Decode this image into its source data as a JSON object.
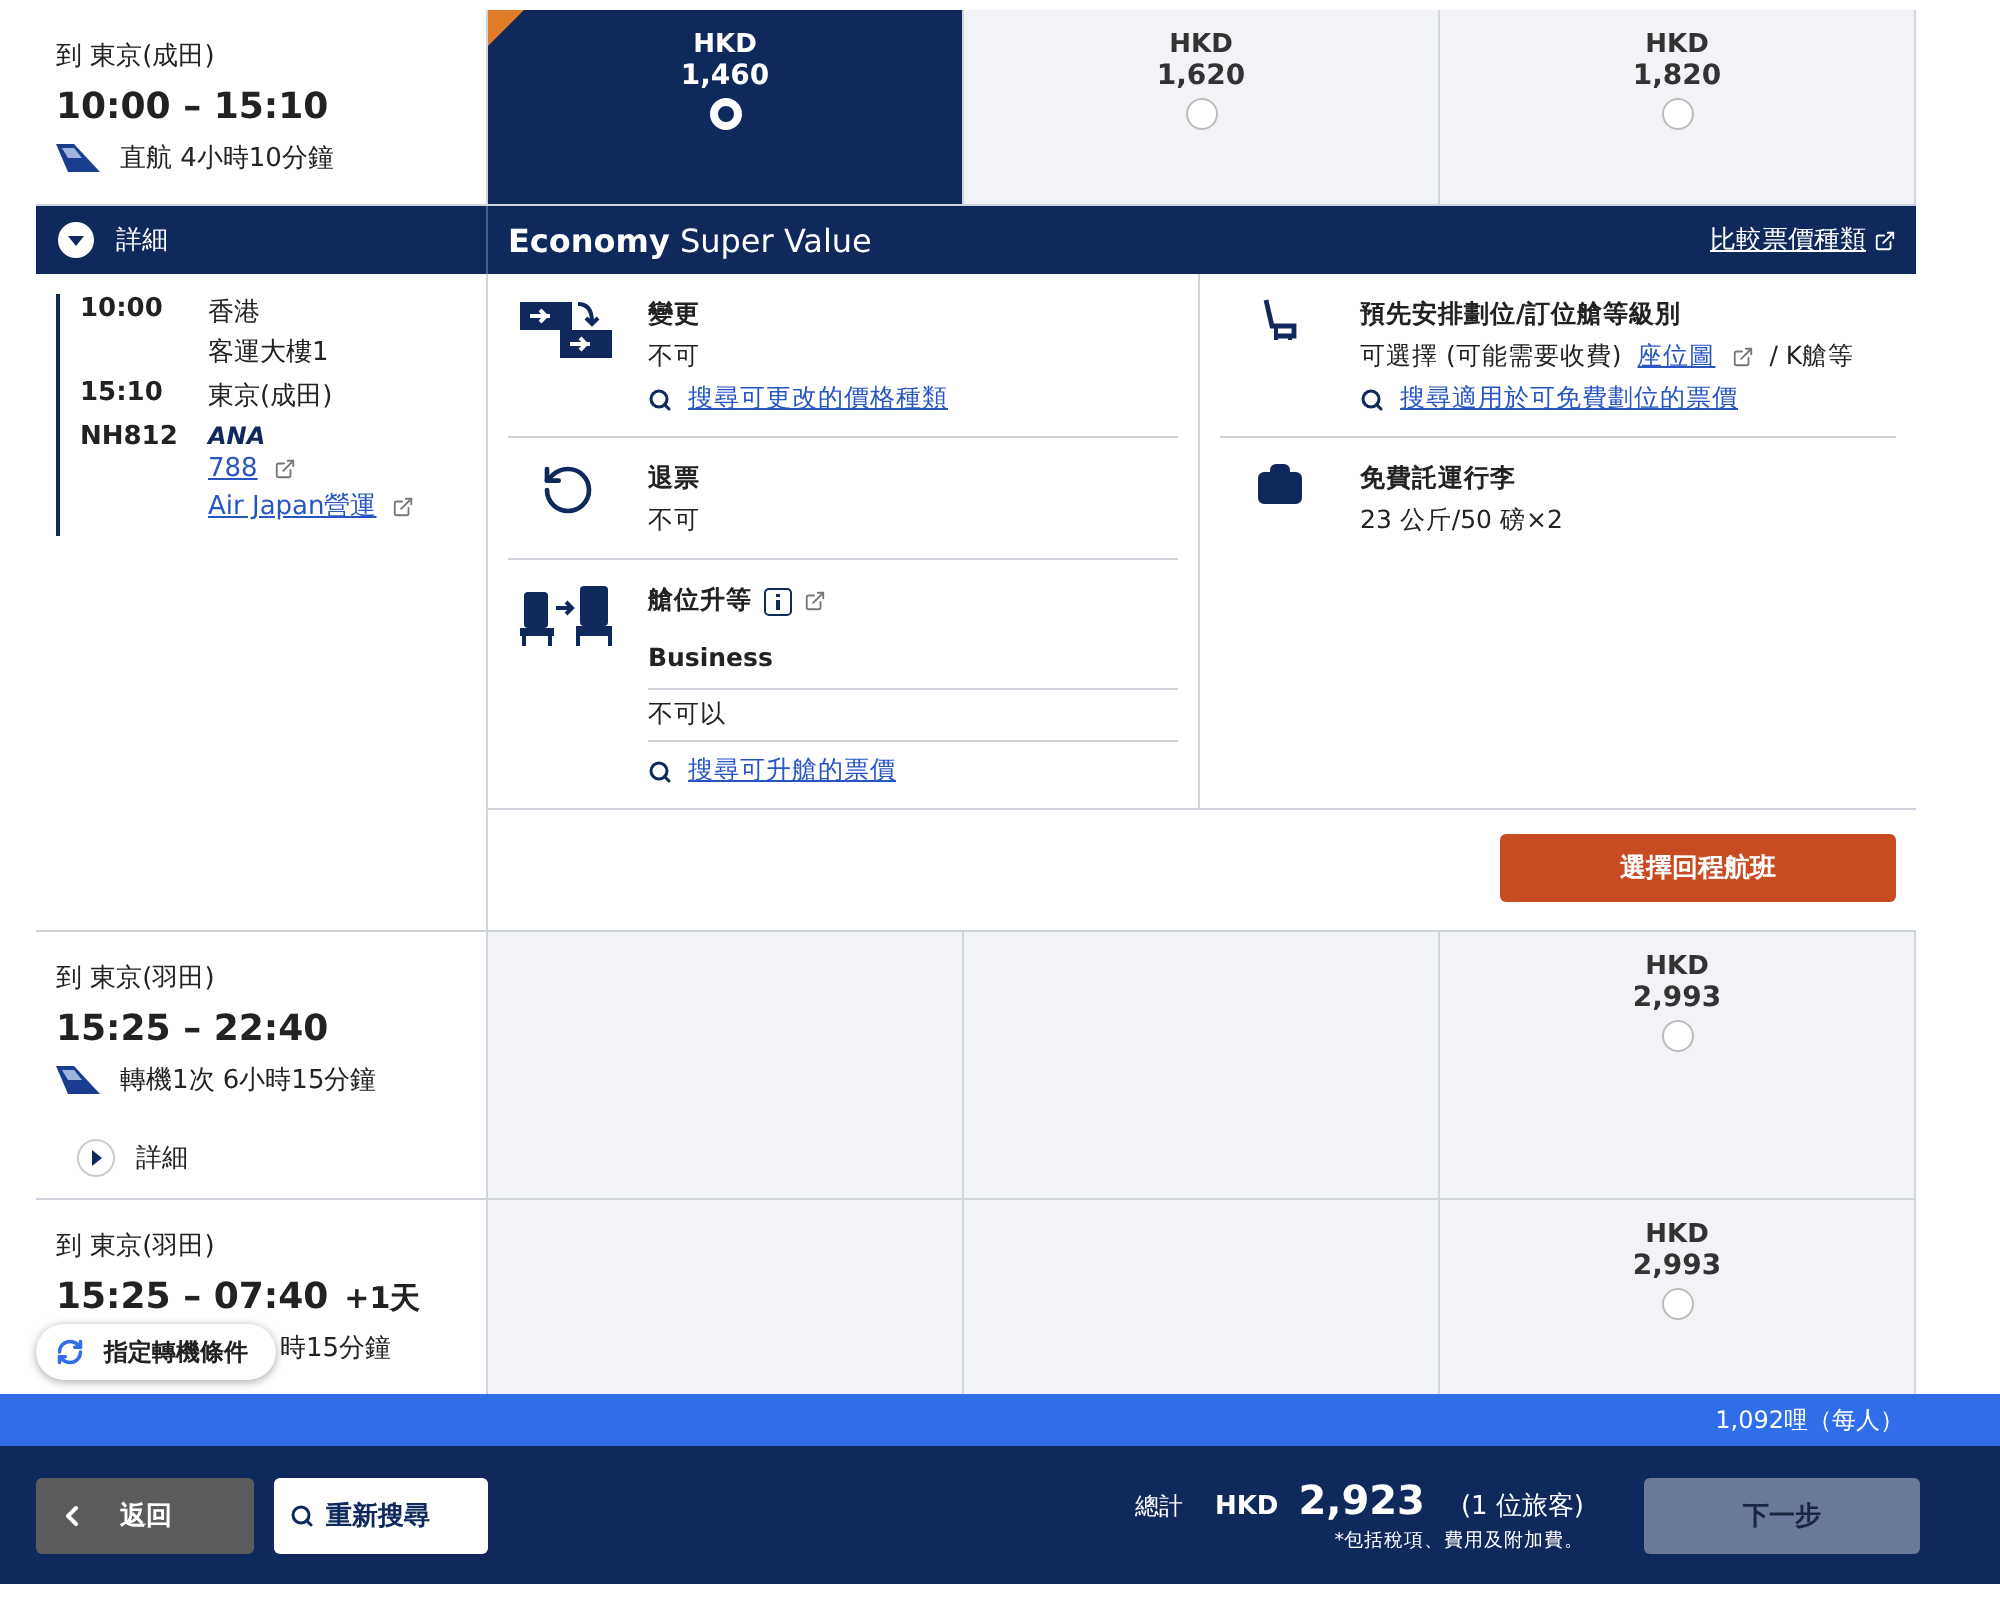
{
  "flights": [
    {
      "destination": "到 東京(成田)",
      "times": "10:00 – 15:10",
      "summary": "直航 4小時10分鐘",
      "details_label": "詳細",
      "expanded": true,
      "fares": [
        {
          "kind": "price",
          "currency": "HKD",
          "amount": "1,460",
          "selected": true
        },
        {
          "kind": "price",
          "currency": "HKD",
          "amount": "1,620",
          "selected": false
        },
        {
          "kind": "price",
          "currency": "HKD",
          "amount": "1,820",
          "selected": false
        }
      ]
    },
    {
      "destination": "到 東京(羽田)",
      "times": "15:25 – 22:40",
      "summary": "轉機1次 6小時15分鐘",
      "details_label": "詳細",
      "expanded": false,
      "fares": [
        {
          "kind": "empty"
        },
        {
          "kind": "empty"
        },
        {
          "kind": "price",
          "currency": "HKD",
          "amount": "2,993",
          "selected": false
        }
      ]
    },
    {
      "destination": "到 東京(羽田)",
      "times": "15:25 – 07:40",
      "day_offset": "+1天",
      "summary": "時15分鐘",
      "fares": [
        {
          "kind": "empty"
        },
        {
          "kind": "empty"
        },
        {
          "kind": "price",
          "currency": "HKD",
          "amount": "2,993",
          "selected": false
        }
      ]
    }
  ],
  "segment": {
    "departure": {
      "time": "10:00",
      "place": "香港",
      "terminal": "客運大樓1"
    },
    "arrival": {
      "time": "15:10",
      "place": "東京(成田)"
    },
    "flight_number": "NH812",
    "airline_logo": "ANA",
    "aircraft": "788",
    "operator": "Air Japan營運"
  },
  "fare_panel": {
    "title": "**Economy** Super Value",
    "compare_link": "比較票價種類",
    "left": [
      {
        "kind": "change",
        "title": "變更",
        "value": "不可",
        "link": "搜尋可更改的價格種類"
      },
      {
        "kind": "refund",
        "title": "退票",
        "value": "不可"
      },
      {
        "kind": "upgrade",
        "title": "艙位升等",
        "class": "Business",
        "value": "不可以",
        "link": "搜尋可升艙的票價"
      }
    ],
    "right": [
      {
        "kind": "seat",
        "title": "預先安排劃位/訂位艙等級別",
        "value": "可選擇 (可能需要收費)",
        "inline_link": "座位圖",
        "suffix": "/ K艙等",
        "link": "搜尋適用於可免費劃位的票價"
      },
      {
        "kind": "baggage",
        "title": "免費託運行李",
        "value": "23 公斤/50 磅×2"
      }
    ],
    "select_button": "選擇回程航班"
  },
  "transfer_filter": "指定轉機條件",
  "miles": "1,092哩（每人）",
  "footer": {
    "back": "返回",
    "research": "重新搜尋",
    "total_label": "總計",
    "currency": "HKD",
    "amount": "2,923",
    "passengers": "(1 位旅客)",
    "note": "*包括稅項、費用及附加費。",
    "next": "下一步",
    "next_disabled": true
  }
}
